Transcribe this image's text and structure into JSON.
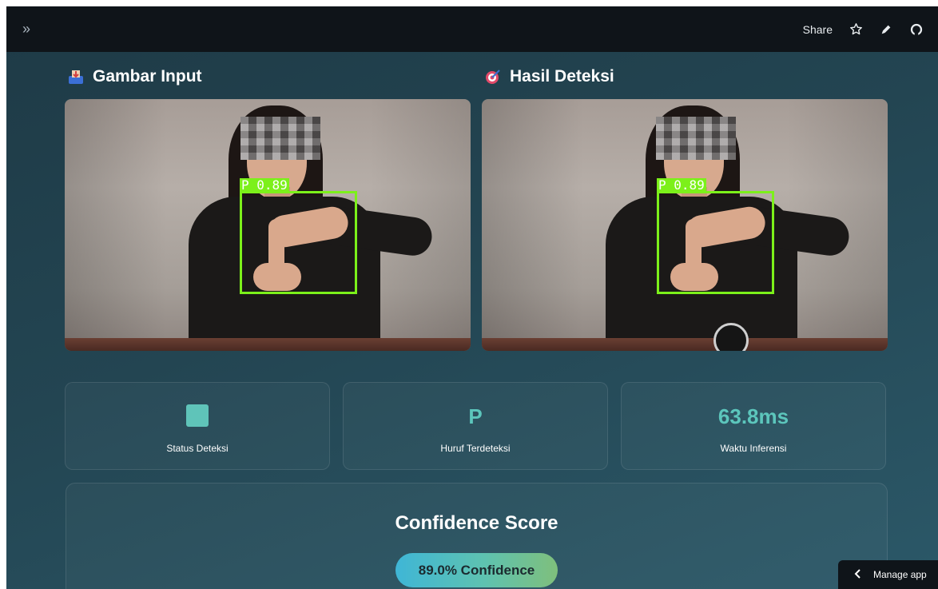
{
  "topbar": {
    "sidebar_toggle": "»",
    "share_label": "Share",
    "icons": [
      "chevrons-right-icon",
      "star-icon",
      "pencil-icon",
      "github-icon"
    ]
  },
  "sections": {
    "input_title": "Gambar Input",
    "input_icon": "inbox-tray-icon",
    "result_title": "Hasil Deteksi",
    "result_icon": "target-dart-icon"
  },
  "detection": {
    "input_label": "P 0.89",
    "result_label": "P 0.89",
    "box_color": "#7cf01a"
  },
  "metrics": {
    "status_caption": "Status Deteksi",
    "status_color": "#5fc4b9",
    "letter_value": "P",
    "letter_caption": "Huruf Terdeteksi",
    "time_value": "63.8ms",
    "time_caption": "Waktu Inferensi"
  },
  "confidence": {
    "title": "Confidence Score",
    "pill": "89.0% Confidence",
    "value": 0.89
  },
  "footer": {
    "manage_app_label": "Manage app"
  },
  "colors": {
    "topbar": "#0f1419",
    "accent": "#5cc6bc",
    "background": "#234552"
  }
}
